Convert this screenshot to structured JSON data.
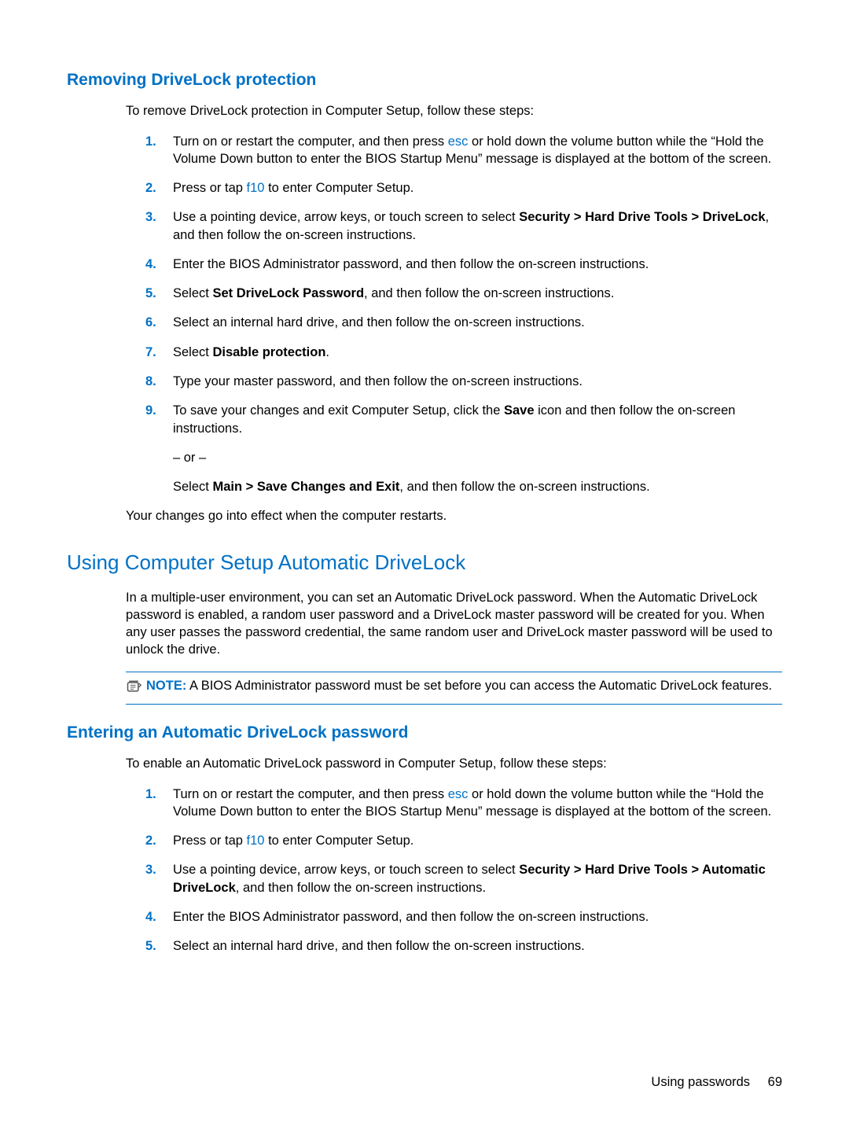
{
  "section1": {
    "title": "Removing DriveLock protection",
    "intro": "To remove DriveLock protection in Computer Setup, follow these steps:",
    "closing": "Your changes go into effect when the computer restarts."
  },
  "steps1": {
    "s1_a": "Turn on or restart the computer, and then press ",
    "s1_key": "esc",
    "s1_b": " or hold down the volume button while the “Hold the Volume Down button to enter the BIOS Startup Menu” message is displayed at the bottom of the screen.",
    "s2_a": "Press or tap ",
    "s2_key": "f10",
    "s2_b": " to enter Computer Setup.",
    "s3_a": "Use a pointing device, arrow keys, or touch screen to select ",
    "s3_bold": "Security > Hard Drive Tools > DriveLock",
    "s3_b": ", and then follow the on-screen instructions.",
    "s4": "Enter the BIOS Administrator password, and then follow the on-screen instructions.",
    "s5_a": "Select ",
    "s5_bold": "Set DriveLock Password",
    "s5_b": ", and then follow the on-screen instructions.",
    "s6": "Select an internal hard drive, and then follow the on-screen instructions.",
    "s7_a": "Select ",
    "s7_bold": "Disable protection",
    "s7_b": ".",
    "s8": "Type your master password, and then follow the on-screen instructions.",
    "s9_a": "To save your changes and exit Computer Setup, click the ",
    "s9_bold": "Save",
    "s9_b": " icon and then follow the on-screen instructions.",
    "s9_or": "– or –",
    "s9_c_a": "Select ",
    "s9_c_bold": "Main > Save Changes and Exit",
    "s9_c_b": ", and then follow the on-screen instructions."
  },
  "section2": {
    "title": "Using Computer Setup Automatic DriveLock",
    "intro": "In a multiple-user environment, you can set an Automatic DriveLock password. When the Automatic DriveLock password is enabled, a random user password and a DriveLock master password will be created for you. When any user passes the password credential, the same random user and DriveLock master password will be used to unlock the drive."
  },
  "note": {
    "label": "NOTE:",
    "text": "   A BIOS Administrator password must be set before you can access the Automatic DriveLock features."
  },
  "section3": {
    "title": "Entering an Automatic DriveLock password",
    "intro": "To enable an Automatic DriveLock password in Computer Setup, follow these steps:"
  },
  "steps2": {
    "s1_a": "Turn on or restart the computer, and then press ",
    "s1_key": "esc",
    "s1_b": " or hold down the volume button while the “Hold the Volume Down button to enter the BIOS Startup Menu” message is displayed at the bottom of the screen.",
    "s2_a": "Press or tap ",
    "s2_key": "f10",
    "s2_b": " to enter Computer Setup.",
    "s3_a": "Use a pointing device, arrow keys, or touch screen to select ",
    "s3_bold": "Security > Hard Drive Tools > Automatic DriveLock",
    "s3_b": ", and then follow the on-screen instructions.",
    "s4": "Enter the BIOS Administrator password, and then follow the on-screen instructions.",
    "s5": "Select an internal hard drive, and then follow the on-screen instructions."
  },
  "nums": {
    "n1": "1.",
    "n2": "2.",
    "n3": "3.",
    "n4": "4.",
    "n5": "5.",
    "n6": "6.",
    "n7": "7.",
    "n8": "8.",
    "n9": "9."
  },
  "footer": {
    "label": "Using passwords",
    "page": "69"
  }
}
